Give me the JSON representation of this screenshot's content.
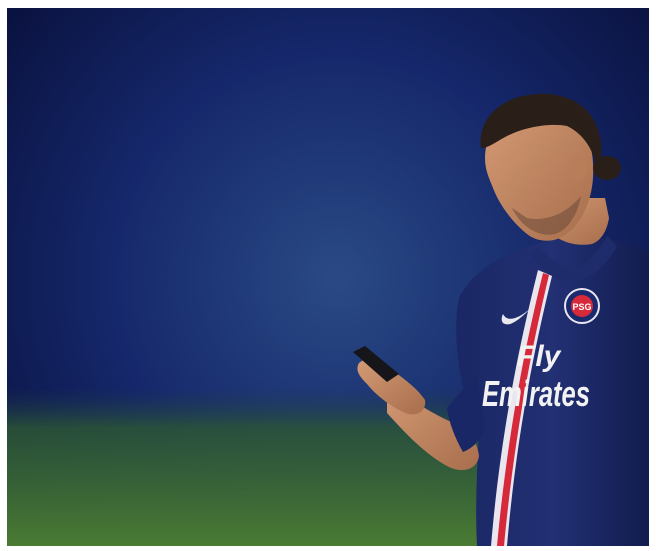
{
  "photo": {
    "subject": "footballer-looking-at-phone",
    "colors": {
      "background_center": "#233f78",
      "background_edge": "#0b1445",
      "grass": "#3b6e2c",
      "shirt": "#18245a",
      "stripe_red": "#d62a3a",
      "skin": "#c48a64",
      "hair": "#2a1e18"
    },
    "shirt_sponsor": {
      "line1": "Fly",
      "line2": "Emirates"
    },
    "crest_letters": "PSG"
  }
}
